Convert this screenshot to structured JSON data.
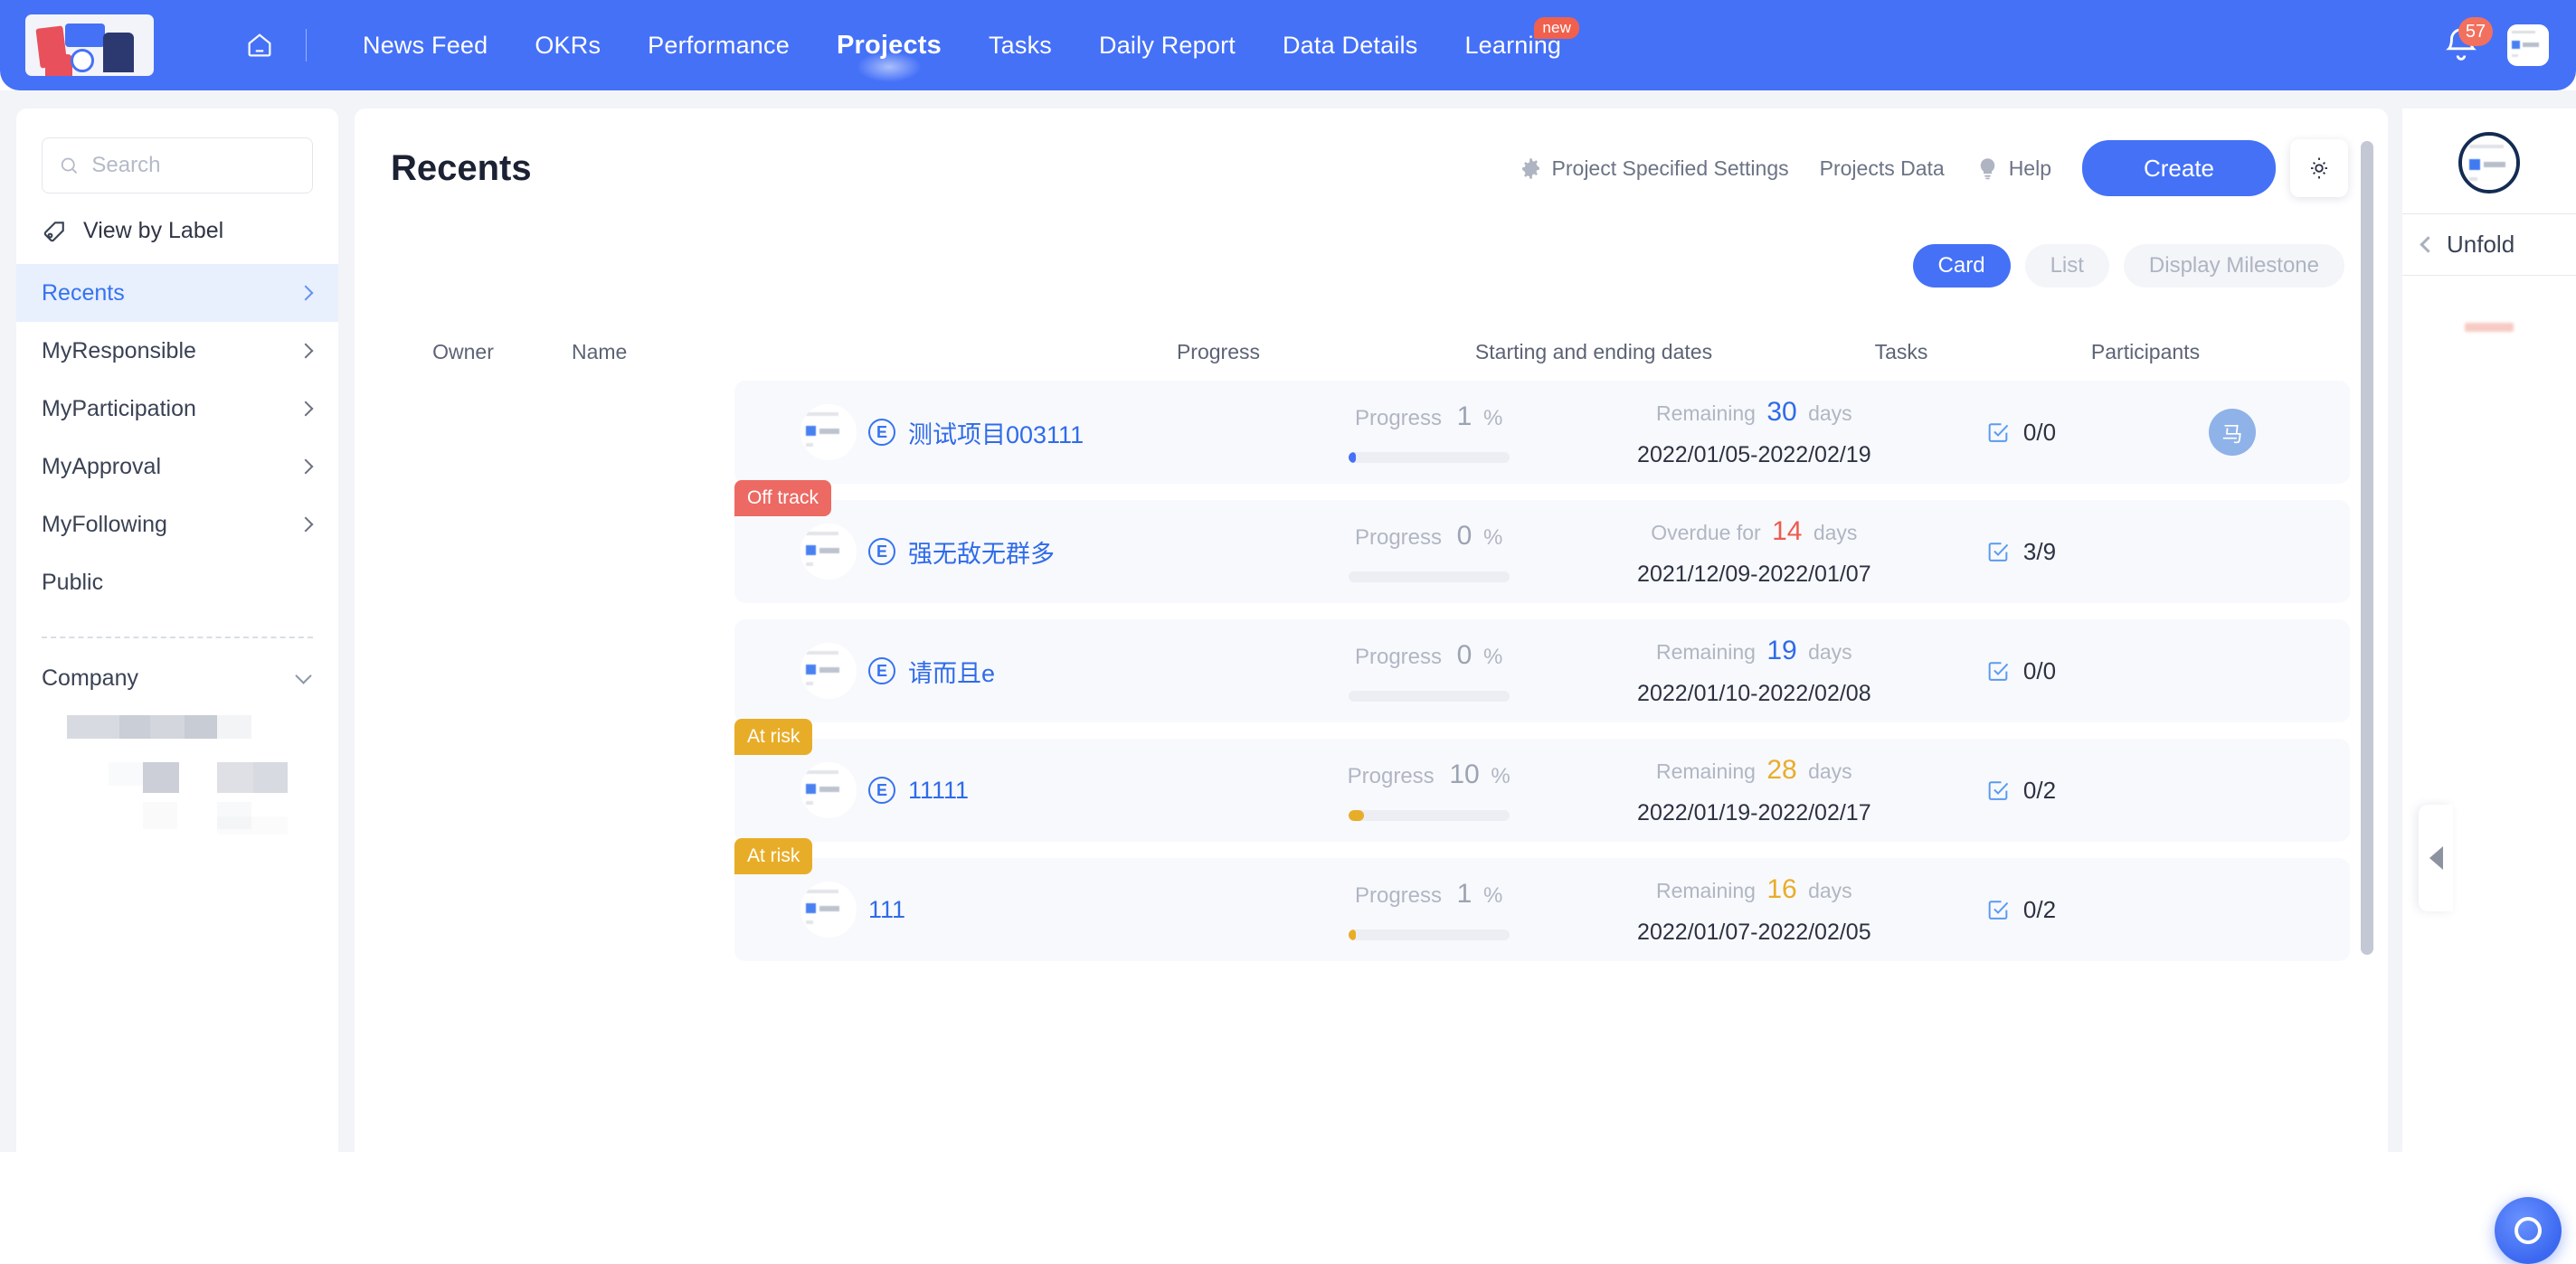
{
  "topnav": {
    "home_icon": "home-icon",
    "items": [
      {
        "label": "News Feed",
        "active": false
      },
      {
        "label": "OKRs",
        "active": false
      },
      {
        "label": "Performance",
        "active": false
      },
      {
        "label": "Projects",
        "active": true
      },
      {
        "label": "Tasks",
        "active": false
      },
      {
        "label": "Daily Report",
        "active": false
      },
      {
        "label": "Data Details",
        "active": false
      },
      {
        "label": "Learning",
        "active": false,
        "badge": "new"
      }
    ],
    "notification_count": "57",
    "accent": "#4571f7",
    "badge_color": "#f0604d"
  },
  "sidebar": {
    "search_placeholder": "Search",
    "search_value": "",
    "view_by_label": "View by Label",
    "items": [
      {
        "label": "Recents",
        "active": true,
        "chevron": true
      },
      {
        "label": "MyResponsible",
        "active": false,
        "chevron": true
      },
      {
        "label": "MyParticipation",
        "active": false,
        "chevron": true
      },
      {
        "label": "MyApproval",
        "active": false,
        "chevron": true
      },
      {
        "label": "MyFollowing",
        "active": false,
        "chevron": true
      },
      {
        "label": "Public",
        "active": false,
        "chevron": false
      }
    ],
    "company_label": "Company"
  },
  "main": {
    "title": "Recents",
    "actions": {
      "project_specified_settings": "Project Specified Settings",
      "projects_data": "Projects Data",
      "help": "Help",
      "create": "Create"
    },
    "view_modes": [
      {
        "label": "Card",
        "active": true
      },
      {
        "label": "List",
        "active": false
      },
      {
        "label": "Display Milestone",
        "active": false
      }
    ],
    "columns": {
      "owner": "Owner",
      "name": "Name",
      "progress": "Progress",
      "dates": "Starting and ending dates",
      "tasks": "Tasks",
      "participants": "Participants"
    },
    "progress_prefix": "Progress",
    "percent_symbol": "%",
    "remaining_prefix": "Remaining",
    "remaining_suffix": "days",
    "overdue_prefix": "Overdue for",
    "overdue_suffix": "days",
    "rows": [
      {
        "badge": null,
        "badge_type": null,
        "has_e_icon": true,
        "e_letter": "E",
        "name": "测试项目003111",
        "progress": 1,
        "progress_color": "#4571f7",
        "date_mode": "remaining",
        "date_days": "30",
        "date_days_color": "#2f6bea",
        "date_range": "2022/01/05-2022/02/19",
        "tasks": "0/0",
        "participants": [
          "马"
        ]
      },
      {
        "badge": "Off track",
        "badge_type": "off",
        "has_e_icon": true,
        "e_letter": "E",
        "name": "强无敌无群多",
        "progress": 0,
        "progress_color": "#4571f7",
        "date_mode": "overdue",
        "date_days": "14",
        "date_days_color": "#ec5b4f",
        "date_range": "2021/12/09-2022/01/07",
        "tasks": "3/9",
        "participants": []
      },
      {
        "badge": null,
        "badge_type": null,
        "has_e_icon": true,
        "e_letter": "E",
        "name": "请而且e",
        "progress": 0,
        "progress_color": "#4571f7",
        "date_mode": "remaining",
        "date_days": "19",
        "date_days_color": "#2f6bea",
        "date_range": "2022/01/10-2022/02/08",
        "tasks": "0/0",
        "participants": []
      },
      {
        "badge": "At risk",
        "badge_type": "risk",
        "has_e_icon": true,
        "e_letter": "E",
        "name": "11111",
        "progress": 10,
        "progress_color": "#e8ad28",
        "date_mode": "remaining",
        "date_days": "28",
        "date_days_color": "#e8ad28",
        "date_range": "2022/01/19-2022/02/17",
        "tasks": "0/2",
        "participants": []
      },
      {
        "badge": "At risk",
        "badge_type": "risk",
        "has_e_icon": false,
        "e_letter": "",
        "name": "111",
        "progress": 1,
        "progress_color": "#e8ad28",
        "date_mode": "remaining",
        "date_days": "16",
        "date_days_color": "#e8ad28",
        "date_range": "2022/01/07-2022/02/05",
        "tasks": "0/2",
        "participants": []
      }
    ]
  },
  "rail": {
    "unfold": "Unfold"
  }
}
